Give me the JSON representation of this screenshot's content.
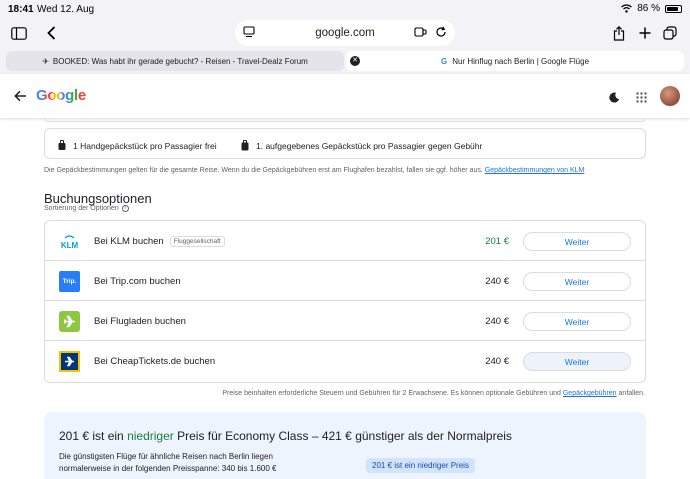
{
  "status_bar": {
    "time": "18:41",
    "date": "Wed 12. Aug",
    "battery": "86 %"
  },
  "browser": {
    "url": "google.com",
    "tabs": [
      {
        "label": "BOOKED: Was habt ihr gerade gebucht? - Reisen - Travel-Dealz Forum"
      },
      {
        "label": "Nur Hinflug nach Berlin | Google Flüge"
      }
    ]
  },
  "google": {
    "logo": "Google"
  },
  "baggage": {
    "carry_on": "1 Handgepäckstück pro Passagier frei",
    "checked": "1. aufgegebenes Gepäckstück pro Passagier gegen Gebühr",
    "note": "Die Gepäckbestimmungen gelten für die gesamte Reise. Wenn du die Gepäckgebühren erst am Flughafen bezahlst, fallen sie ggf. höher aus.",
    "note_link": "Gepäckbestimmungen von KLM"
  },
  "booking": {
    "title": "Buchungsoptionen",
    "subtitle": "Sortierung der Optionen",
    "options": [
      {
        "name": "Bei KLM buchen",
        "badge": "Fluggesellschaft",
        "price": "201 €",
        "button": "Weiter",
        "logo_text": "KLM"
      },
      {
        "name": "Bei Trip.com buchen",
        "price": "240 €",
        "button": "Weiter",
        "logo_text": "Trip."
      },
      {
        "name": "Bei Flugladen buchen",
        "price": "240 €",
        "button": "Weiter"
      },
      {
        "name": "Bei CheapTickets.de buchen",
        "price": "240 €",
        "button": "Weiter"
      }
    ],
    "tax_note": "Preise beinhalten erforderliche Steuern und Gebühren für 2 Erwachsene. Es können optionale Gebühren und",
    "tax_link": "Gepäckgebühren",
    "tax_tail": "anfallen."
  },
  "insight": {
    "title_a": "201 € ist ein",
    "title_low": "niedriger",
    "title_b": "Preis für Economy Class – 421 € günstiger als der Normalpreis",
    "desc": "Die günstigsten Flüge für ähnliche Reisen nach Berlin liegen normalerweise in der folgenden Preisspanne: 340 bis 1.600 €",
    "pill": "201 € ist ein niedriger Preis"
  },
  "colors": {
    "accent": "#1a73e8",
    "good_price": "#188038",
    "card_border": "#dadce0"
  }
}
